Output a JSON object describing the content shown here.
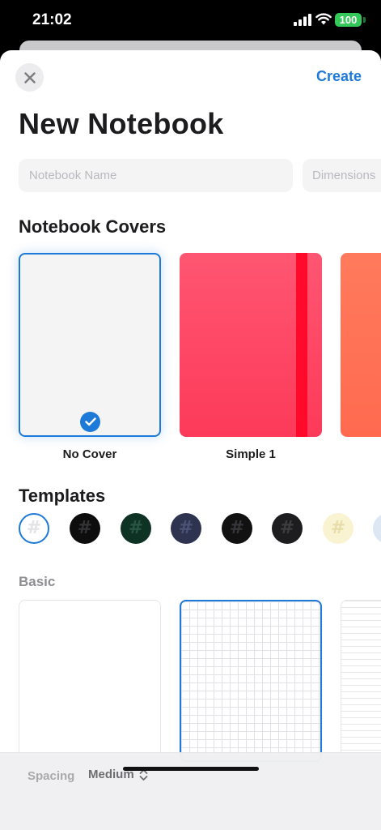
{
  "status_bar": {
    "time": "21:02",
    "battery": "100"
  },
  "header": {
    "create_label": "Create",
    "title": "New Notebook"
  },
  "name_field": {
    "placeholder": "Notebook Name"
  },
  "dimensions_field": {
    "placeholder": "Dimensions"
  },
  "covers": {
    "heading": "Notebook Covers",
    "items": [
      {
        "label": "No Cover",
        "selected": true
      },
      {
        "label": "Simple 1",
        "color": "#fe4a67",
        "band_color": "#ff0a2a"
      }
    ],
    "next_color": "#ff7257"
  },
  "templates": {
    "heading": "Templates",
    "swatches": [
      {
        "bg": "#ffffff",
        "glyph_color": "#e3e3e6",
        "selected": true
      },
      {
        "bg": "#0d0d0d",
        "glyph_color": "#333335"
      },
      {
        "bg": "#0e3325",
        "glyph_color": "#2a5444"
      },
      {
        "bg": "#2e3350",
        "glyph_color": "#4c5276"
      },
      {
        "bg": "#111111",
        "glyph_color": "#36363a"
      },
      {
        "bg": "#1d1d1f",
        "glyph_color": "#3d3d40"
      },
      {
        "bg": "#faf3d2",
        "glyph_color": "#e7dcaa"
      },
      {
        "bg": "#dde7f3",
        "glyph_color": "#c3d1e3"
      }
    ],
    "glyph": "#",
    "group_label": "Basic"
  },
  "bottom_bar": {
    "spacing_label": "Spacing",
    "spacing_value": "Medium"
  },
  "accent_color": "#1e7ad8"
}
